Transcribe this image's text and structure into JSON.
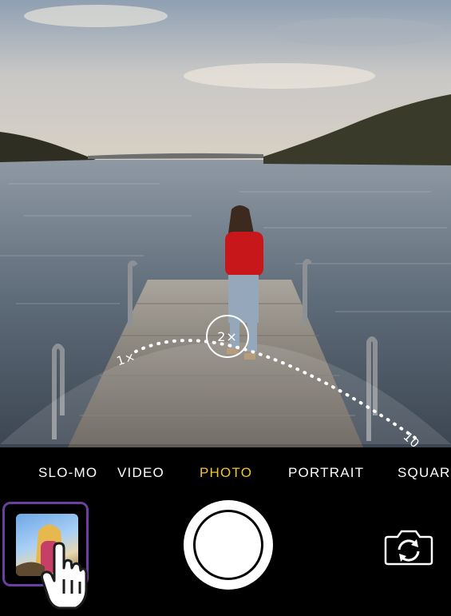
{
  "camera": {
    "modes": [
      "SLO-MO",
      "VIDEO",
      "PHOTO",
      "PORTRAIT",
      "SQUARE"
    ],
    "active_mode": "PHOTO",
    "zoom": {
      "min_label": "1×",
      "current_label": "2×",
      "max_label_partial": "10"
    },
    "accent_color": "#f4c430"
  },
  "controls": {
    "thumbnail_icon": "last-photo-thumbnail",
    "shutter_icon": "shutter-button",
    "flip_icon": "camera-flip-icon",
    "cursor_icon": "hand-pointer-cursor"
  }
}
